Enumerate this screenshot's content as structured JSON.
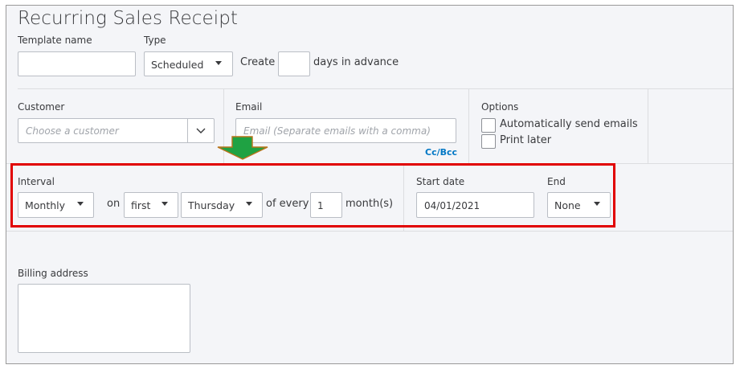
{
  "page": {
    "title": "Recurring Sales Receipt"
  },
  "template": {
    "template_name_label": "Template name",
    "template_name_value": "",
    "type_label": "Type",
    "type_value": "Scheduled",
    "create_label": "Create",
    "days_value": "",
    "days_suffix": "days in advance"
  },
  "customer": {
    "label": "Customer",
    "placeholder": "Choose a customer"
  },
  "email": {
    "label": "Email",
    "placeholder": "Email (Separate emails with a comma)",
    "cc_bcc": "Cc/Bcc"
  },
  "options": {
    "label": "Options",
    "auto_send": "Automatically send emails",
    "print_later": "Print later"
  },
  "interval": {
    "label": "Interval",
    "frequency": "Monthly",
    "on_label": "on",
    "week": "first",
    "day": "Thursday",
    "of_every_label": "of every",
    "count": "1",
    "unit": "month(s)"
  },
  "schedule": {
    "start_date_label": "Start date",
    "start_date_value": "04/01/2021",
    "end_label": "End",
    "end_value": "None"
  },
  "billing": {
    "label": "Billing address",
    "value": ""
  },
  "annotation": {
    "highlight_color": "#e10000",
    "arrow_color": "#1fa243"
  }
}
